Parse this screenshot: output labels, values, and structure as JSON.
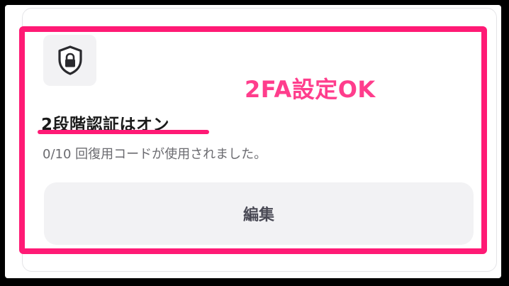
{
  "annotation": {
    "text": "2FA設定OK",
    "color": "#ff3d8c"
  },
  "security_card": {
    "icon": "shield-lock-icon",
    "title": "2段階認証はオン",
    "subtitle": "0/10 回復用コードが使用されました。",
    "edit_button_label": "編集"
  },
  "colors": {
    "highlight": "#ff1a75",
    "background": "#000000",
    "card": "#ffffff",
    "tile": "#f2f2f4"
  }
}
